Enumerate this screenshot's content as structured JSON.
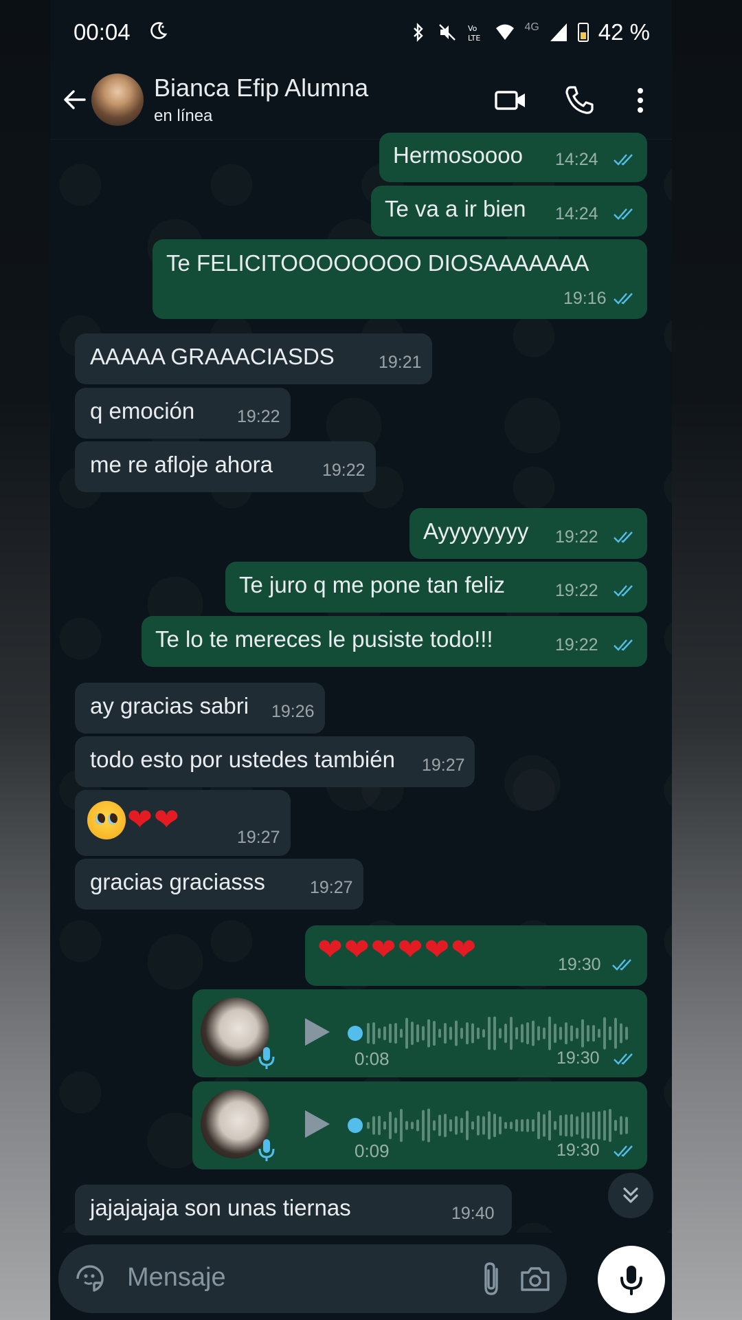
{
  "status_bar": {
    "time": "00:04",
    "battery": "42 %",
    "network": "4G"
  },
  "header": {
    "contact_name": "Bianca Efip Alumna",
    "contact_status": "en línea"
  },
  "messages": [
    {
      "dir": "out",
      "text": "Hermosoooo",
      "time": "14:24"
    },
    {
      "dir": "out",
      "text": "Te va a ir bien",
      "time": "14:24"
    },
    {
      "dir": "out",
      "text": "Te FELICITOOOOOOOO DIOSAAAAAAA",
      "time": "19:16"
    },
    {
      "dir": "in",
      "text": "AAAAA GRAAACIASDS",
      "time": "19:21"
    },
    {
      "dir": "in",
      "text": "q emoción",
      "time": "19:22"
    },
    {
      "dir": "in",
      "text": "me re afloje ahora",
      "time": "19:22"
    },
    {
      "dir": "out",
      "text": "Ayyyyyyyy",
      "time": "19:22"
    },
    {
      "dir": "out",
      "text": "Te juro q me pone tan feliz",
      "time": "19:22"
    },
    {
      "dir": "out",
      "text": "Te lo te mereces le pusiste todo!!!",
      "time": "19:22"
    },
    {
      "dir": "in",
      "text": "ay gracias sabri",
      "time": "19:26"
    },
    {
      "dir": "in",
      "text": "todo esto por ustedes también",
      "time": "19:27"
    },
    {
      "dir": "in",
      "text": "🥺❤️❤️",
      "time": "19:27"
    },
    {
      "dir": "in",
      "text": "gracias graciasss",
      "time": "19:27"
    },
    {
      "dir": "out",
      "text": "❤️❤️❤️❤️❤️❤️",
      "time": "19:30"
    },
    {
      "dir": "out",
      "type": "voice",
      "duration": "0:08",
      "time": "19:30"
    },
    {
      "dir": "out",
      "type": "voice",
      "duration": "0:09",
      "time": "19:30"
    },
    {
      "dir": "in",
      "text": "jajajajaja son unas tiernas",
      "time": "19:40"
    }
  ],
  "input": {
    "placeholder": "Mensaje"
  },
  "icons": {
    "back": "arrow-left-icon",
    "video": "video-call-icon",
    "call": "phone-icon",
    "menu": "more-vert-icon",
    "emoji": "sticker-icon",
    "attach": "paperclip-icon",
    "camera": "camera-icon",
    "mic": "mic-icon",
    "scroll": "double-chevron-down-icon",
    "read_receipt": "double-check-icon"
  },
  "colors": {
    "outgoing_bubble": "#144d37",
    "incoming_bubble": "#202c33",
    "read_tick": "#53bdeb",
    "background": "#0b141a",
    "heart": "#e31b23"
  }
}
